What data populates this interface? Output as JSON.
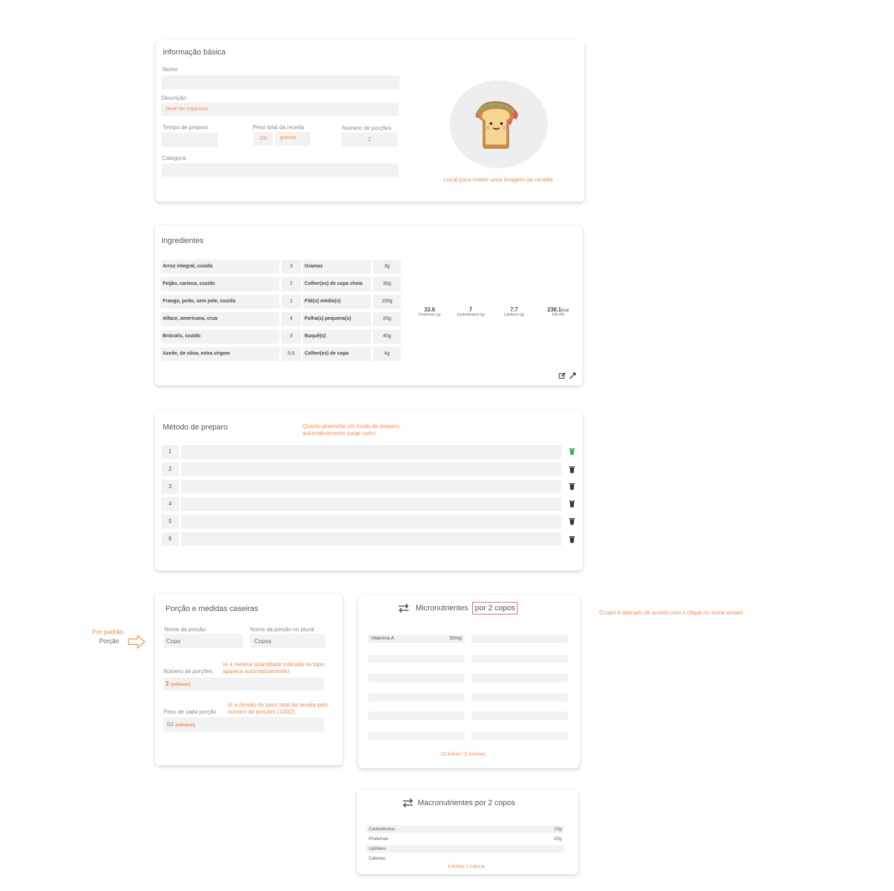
{
  "basic": {
    "title": "Informação básica",
    "nome_label": "Nome",
    "descricao_label": "Descrição",
    "descricao_value": "Deve ser espanovo",
    "tempo_label": "Tempo de preparo",
    "peso_label": "Peso total da receita",
    "peso_value": "100",
    "peso_unit": "gramas",
    "porcoes_label": "Número de porções",
    "porcoes_value": "2",
    "categoria_label": "Categoria",
    "image_note": "Local para inserir uma imagem da receita"
  },
  "ingredients": {
    "title": "Ingredientes",
    "rows": [
      {
        "name": "Arroz integral, cozido",
        "qty": "3",
        "unit": "Gramas",
        "weight": "3g"
      },
      {
        "name": "Feijão, carioca, cozido",
        "qty": "2",
        "unit": "Colher(es) de sopa cheia",
        "weight": "30g"
      },
      {
        "name": "Frango, peito, sem pele, cozido",
        "qty": "1",
        "unit": "Filé(s) médio(s)",
        "weight": "100g"
      },
      {
        "name": "Alface, americana, crua",
        "qty": "4",
        "unit": "Folha(s) pequena(s)",
        "weight": "20g"
      },
      {
        "name": "Brócolis, cozido",
        "qty": "3",
        "unit": "Buquê(s)",
        "weight": "45g"
      },
      {
        "name": "Azeite, de oliva, extra virgem",
        "qty": "0.5",
        "unit": "Colher(es) de sopa",
        "weight": "4g"
      }
    ],
    "totals": {
      "protein_value": "33.6",
      "protein_label": "Proteínas (g)",
      "carb_value": "7",
      "carb_label": "Carboidratos (g)",
      "lipid_value": "7.7",
      "lipid_label": "Lipídeos (g)",
      "kcal_value": "238.1",
      "kcal_unit": "kcal",
      "kcal_pct": "100.0%"
    }
  },
  "method": {
    "title": "Método de preparo",
    "note": "Quanto preenche um modo de preparo, automaticamente surge outro.",
    "steps": [
      "1",
      "2",
      "3",
      "4",
      "5",
      "6"
    ]
  },
  "portion": {
    "title": "Porção e medidas caseiras",
    "nome_label": "Nome da porção",
    "nome_value": "Copo",
    "plural_label": "Nome da porção no plural",
    "plural_value": "Copos",
    "numero_label": "Número de porções",
    "numero_note": "(é a mesma quantidade indicada no topo, aparece automaticamente)",
    "numero_value": "2",
    "editavel": "(editável)",
    "peso_label": "Peso de cada porção",
    "peso_note": "(é a divisão do peso total da receita pelo número de porções (100/2)",
    "peso_value": "50",
    "default_note_title": "Por padrão",
    "default_note_value": "Porção"
  },
  "micro": {
    "title": "Micronutrientes",
    "title_suffix": "por 2 copos",
    "row1_name": "Vitamina A",
    "row1_value": "50mg",
    "footer": "12 linhas / 2 colunas",
    "side_note": "O caro é alterado de acordo com o clique no ícone arrows"
  },
  "macro": {
    "title": "Macronutrientes por 2 copos",
    "rows": [
      {
        "name": "Carboidratos",
        "value": "10g"
      },
      {
        "name": "Proteínas",
        "value": "20g"
      },
      {
        "name": "Lipídeos",
        "value": ""
      },
      {
        "name": "Calorias",
        "value": ""
      }
    ],
    "footer": "4 linhas 1 coluna"
  }
}
